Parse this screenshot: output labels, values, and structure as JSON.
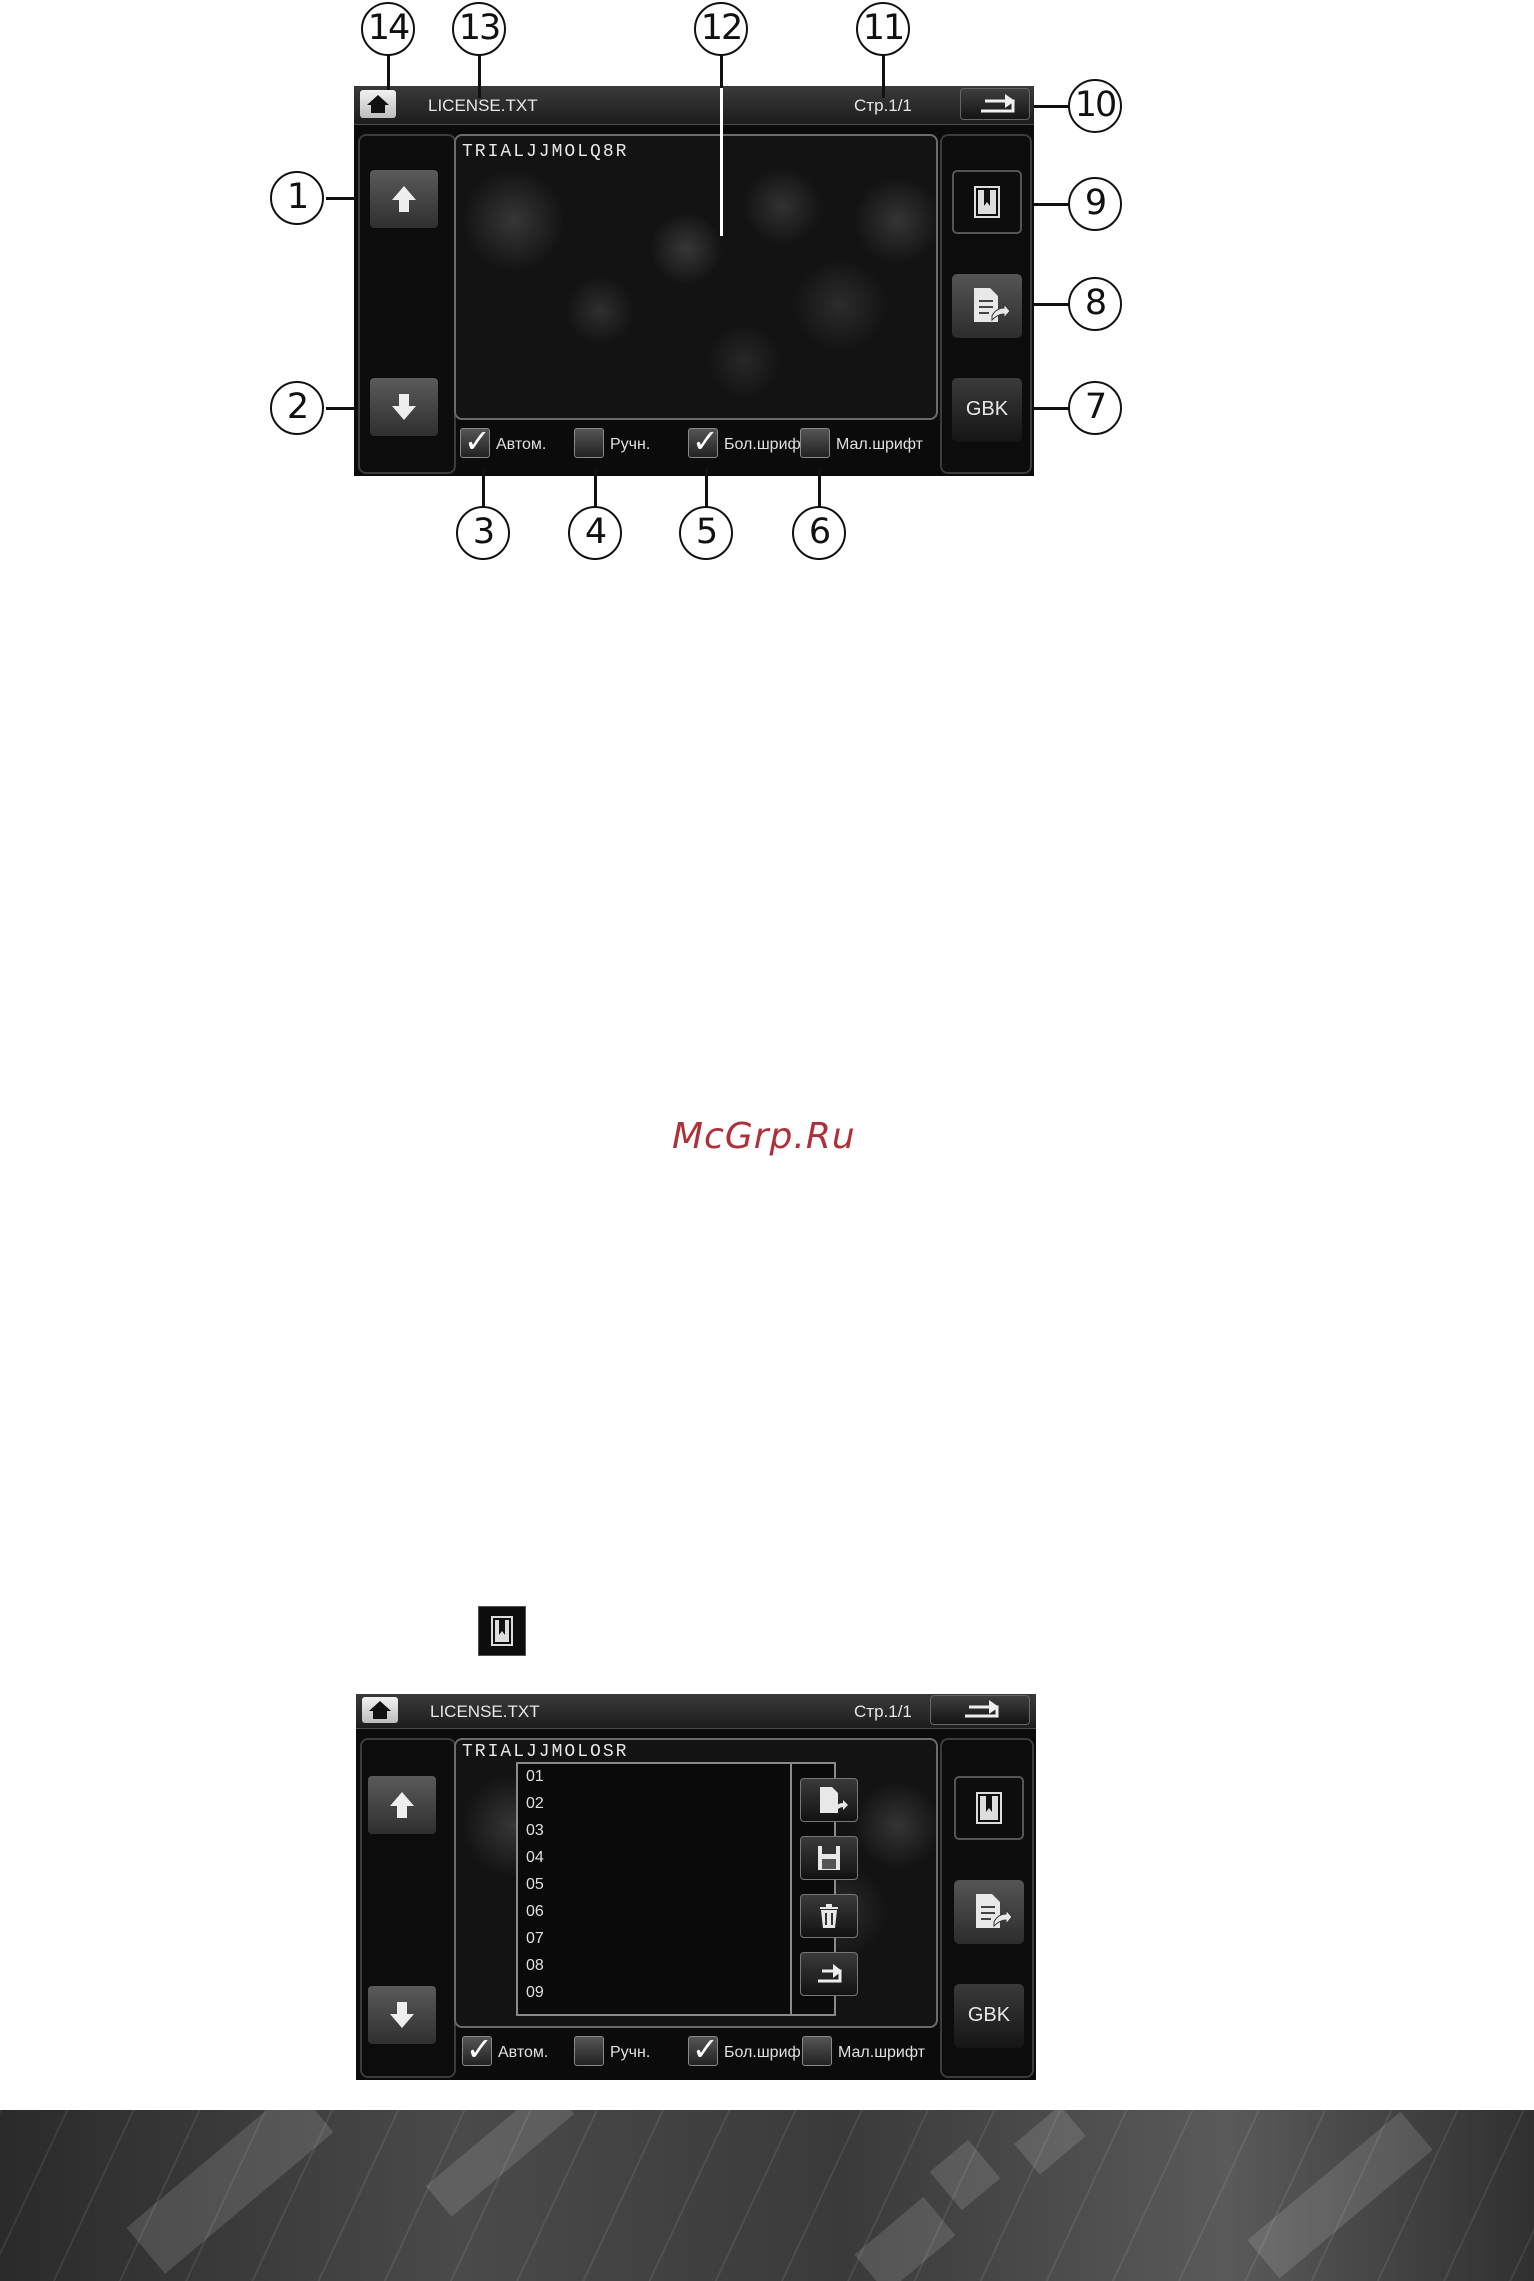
{
  "callouts": [
    "1",
    "2",
    "3",
    "4",
    "5",
    "6",
    "7",
    "8",
    "9",
    "10",
    "11",
    "12",
    "13",
    "14"
  ],
  "screen1": {
    "filename": "LICENSE.TXT",
    "page": "Стр.1/1",
    "document_text": "TRIALJJMOLQ8R",
    "checkboxes": {
      "auto": {
        "label": "Автом.",
        "checked": true
      },
      "manual": {
        "label": "Ручн.",
        "checked": false
      },
      "big_font": {
        "label": "Бол.шриф",
        "checked": true
      },
      "small_font": {
        "label": "Мал.шрифт",
        "checked": false
      }
    },
    "encoding_button": "GBK",
    "icons": [
      "home-icon",
      "return-icon",
      "arrow-up-icon",
      "arrow-down-icon",
      "bookmark-icon",
      "goto-bookmark-icon"
    ]
  },
  "watermark": "McGrp.Ru",
  "screen2": {
    "filename": "LICENSE.TXT",
    "page": "Стр.1/1",
    "document_text": "TRIALJJMOLOSR",
    "bookmarks": [
      "01",
      "02",
      "03",
      "04",
      "05",
      "06",
      "07",
      "08",
      "09"
    ],
    "checkboxes": {
      "auto": {
        "label": "Автом.",
        "checked": true
      },
      "manual": {
        "label": "Ручн.",
        "checked": false
      },
      "big_font": {
        "label": "Бол.шриф",
        "checked": true
      },
      "small_font": {
        "label": "Мал.шрифт",
        "checked": false
      }
    },
    "encoding_button": "GBK",
    "bookmark_panel_icons": [
      "goto-bookmark-icon",
      "save-icon",
      "delete-icon",
      "return-icon"
    ]
  },
  "colors": {
    "watermark": "#b0303a",
    "screen_bg": "#0b0b0b"
  }
}
